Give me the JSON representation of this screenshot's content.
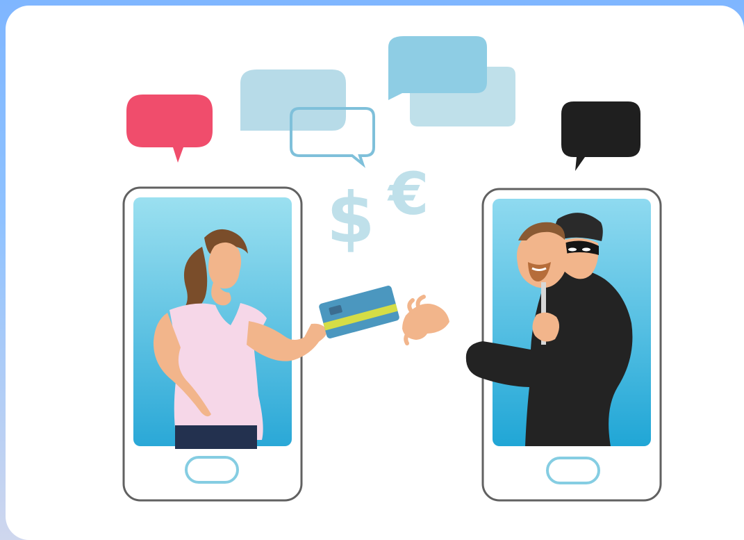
{
  "scene": {
    "symbols": {
      "dollar": "$",
      "euro": "€"
    },
    "colors": {
      "frame_gradient_top": "#7fb6ff",
      "frame_gradient_bottom": "#cfd7ee",
      "card_background": "#ffffff",
      "screen_blue": "#45b9df",
      "speech_bubble_pink": "#f04d6c",
      "speech_bubble_black": "#1f1f1f",
      "speech_bubble_blue": "#8ecde4",
      "card_blue": "#4b97bf",
      "card_stripe": "#d5dd46",
      "shirt_pink": "#f6d7e8",
      "thief_black": "#232323"
    }
  }
}
